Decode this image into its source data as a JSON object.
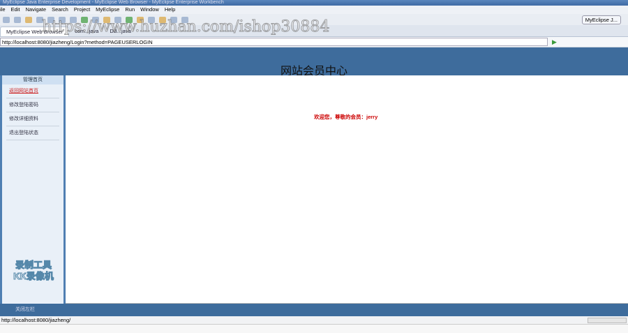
{
  "window": {
    "title": "MyEclipse Java Enterprise Development - MyEclipse Web Browser - MyEclipse Enterprise Workbench"
  },
  "menu": [
    "ile",
    "Edit",
    "Navigate",
    "Search",
    "Project",
    "MyEclipse",
    "Run",
    "Window",
    "Help"
  ],
  "perspective": "MyEclipse J...",
  "tabs": [
    "MyEclipse Web Browser",
    "com...java",
    "DB...java"
  ],
  "address": "http://localhost:8080/jiazheng/Login?method=PAGEUSERLOGIN",
  "page": {
    "title": "网站会员中心",
    "welcome": "欢迎您，尊敬的会员：jerry"
  },
  "sidebar": {
    "header": "管理首页",
    "items": [
      "返回网站首页",
      "修改登陆密码",
      "修改详细资料",
      "退出登陆状态"
    ]
  },
  "bottombar": {
    "label": "关闭左栏"
  },
  "status": {
    "url": "http://localhost:8080/jiazheng/"
  },
  "watermark": {
    "url": "https://www.huzhan.com/ishop30884",
    "recorder": "录制工具 KK录像机"
  }
}
